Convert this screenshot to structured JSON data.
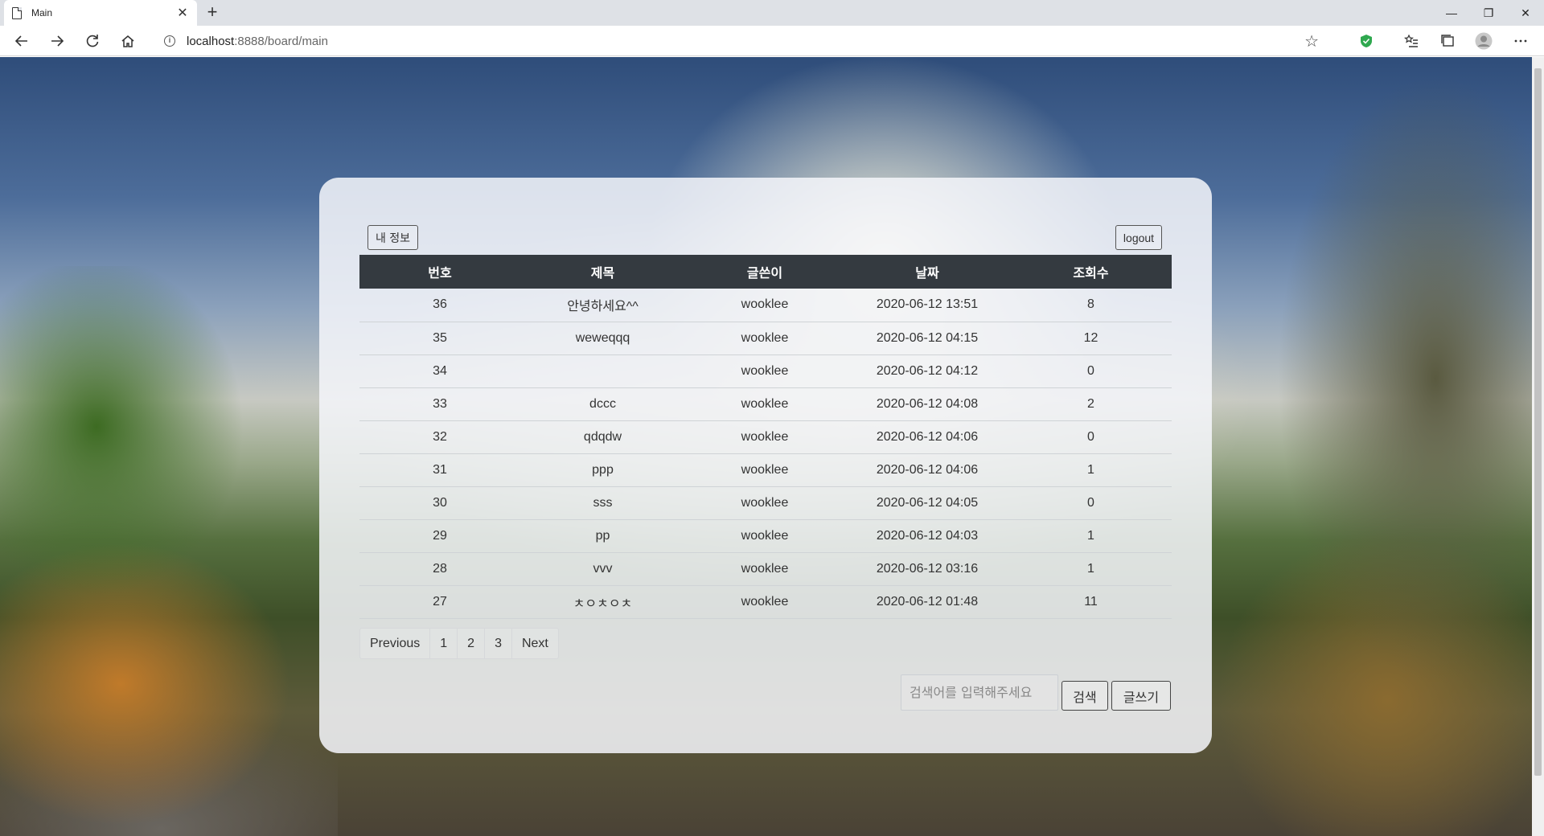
{
  "browser": {
    "tab_title": "Main",
    "new_tab": "+",
    "url_host": "localhost",
    "url_rest": ":8888/board/main",
    "window_controls": [
      "—",
      "❐",
      "✕"
    ]
  },
  "board": {
    "my_info_label": "내 정보",
    "logout_label": "logout",
    "columns": [
      "번호",
      "제목",
      "글쓴이",
      "날짜",
      "조회수"
    ],
    "rows": [
      {
        "num": "36",
        "title": "안녕하세요^^",
        "writer": "wooklee",
        "date": "2020-06-12 13:51",
        "views": "8"
      },
      {
        "num": "35",
        "title": "weweqqq",
        "writer": "wooklee",
        "date": "2020-06-12 04:15",
        "views": "12"
      },
      {
        "num": "34",
        "title": "",
        "writer": "wooklee",
        "date": "2020-06-12 04:12",
        "views": "0"
      },
      {
        "num": "33",
        "title": "dccc",
        "writer": "wooklee",
        "date": "2020-06-12 04:08",
        "views": "2"
      },
      {
        "num": "32",
        "title": "qdqdw",
        "writer": "wooklee",
        "date": "2020-06-12 04:06",
        "views": "0"
      },
      {
        "num": "31",
        "title": "ppp",
        "writer": "wooklee",
        "date": "2020-06-12 04:06",
        "views": "1"
      },
      {
        "num": "30",
        "title": "sss",
        "writer": "wooklee",
        "date": "2020-06-12 04:05",
        "views": "0"
      },
      {
        "num": "29",
        "title": "pp",
        "writer": "wooklee",
        "date": "2020-06-12 04:03",
        "views": "1"
      },
      {
        "num": "28",
        "title": "vvv",
        "writer": "wooklee",
        "date": "2020-06-12 03:16",
        "views": "1"
      },
      {
        "num": "27",
        "title": "ㅊㅇㅊㅇㅊ",
        "writer": "wooklee",
        "date": "2020-06-12 01:48",
        "views": "11"
      }
    ],
    "pagination": [
      "Previous",
      "1",
      "2",
      "3",
      "Next"
    ],
    "search_placeholder": "검색어를 입력해주세요",
    "search_label": "검색",
    "write_label": "글쓰기"
  }
}
